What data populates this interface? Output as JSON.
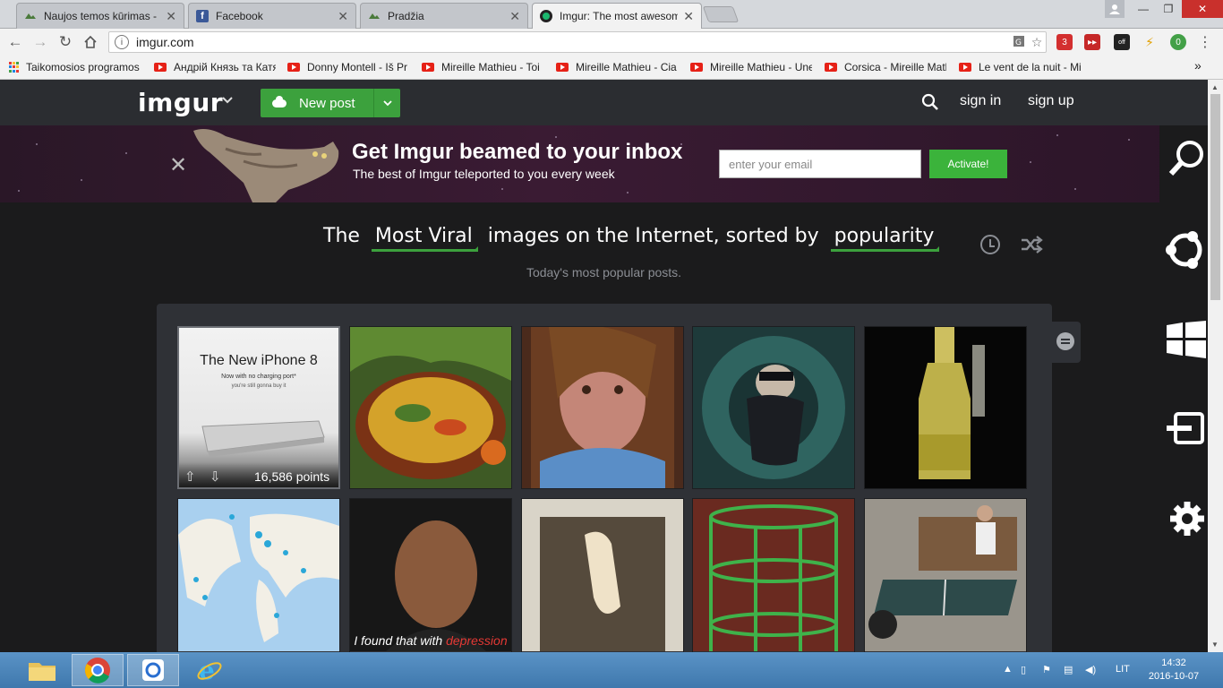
{
  "browser": {
    "tabs": [
      {
        "title": "Naujos temos kūrimas - (",
        "active": false,
        "icon": "page-icon"
      },
      {
        "title": "Facebook",
        "active": false,
        "icon": "facebook-icon"
      },
      {
        "title": "Pradžia",
        "active": false,
        "icon": "page-icon"
      },
      {
        "title": "Imgur: The most awesom",
        "active": true,
        "icon": "imgur-icon"
      }
    ],
    "url": "imgur.com",
    "bookmarks": {
      "apps": "Taikomosios programos",
      "items": [
        "Андрій Князь та Катя",
        "Donny Montell - Iš Pr",
        "Mireille Mathieu - Toi",
        "Mireille Mathieu - Cia",
        "Mireille Mathieu - Une",
        "Corsica - Mireille Matl",
        "Le vent de la nuit - Mi"
      ],
      "overflow": "»"
    },
    "extensions": {
      "badge1": "3",
      "badge2": "off",
      "badge3": "0"
    }
  },
  "header": {
    "logo": "imgur",
    "new_post": "New post",
    "sign_in": "sign in",
    "sign_up": "sign up"
  },
  "banner": {
    "title": "Get Imgur beamed to your inbox",
    "subtitle": "The best of Imgur teleported to you every week",
    "email_placeholder": "enter your email",
    "activate": "Activate!"
  },
  "main": {
    "headline_pre": "The",
    "headline_section": "Most Viral",
    "headline_mid": "images on the Internet, sorted by",
    "headline_sort": "popularity",
    "tagline": "Today's most popular posts.",
    "first_post": {
      "title": "The New iPhone 8",
      "sub1": "Now with no charging port*",
      "sub2": "you're still gonna buy it",
      "points": "16,586 points"
    },
    "meme_caption_a": "I found that with ",
    "meme_caption_b": "depression"
  },
  "taskbar": {
    "lang": "LIT",
    "time": "14:32",
    "date": "2016-10-07"
  },
  "colors": {
    "accent_green": "#3ca13d",
    "header_bg": "#2b2d31",
    "page_bg": "#1b1b1c"
  }
}
